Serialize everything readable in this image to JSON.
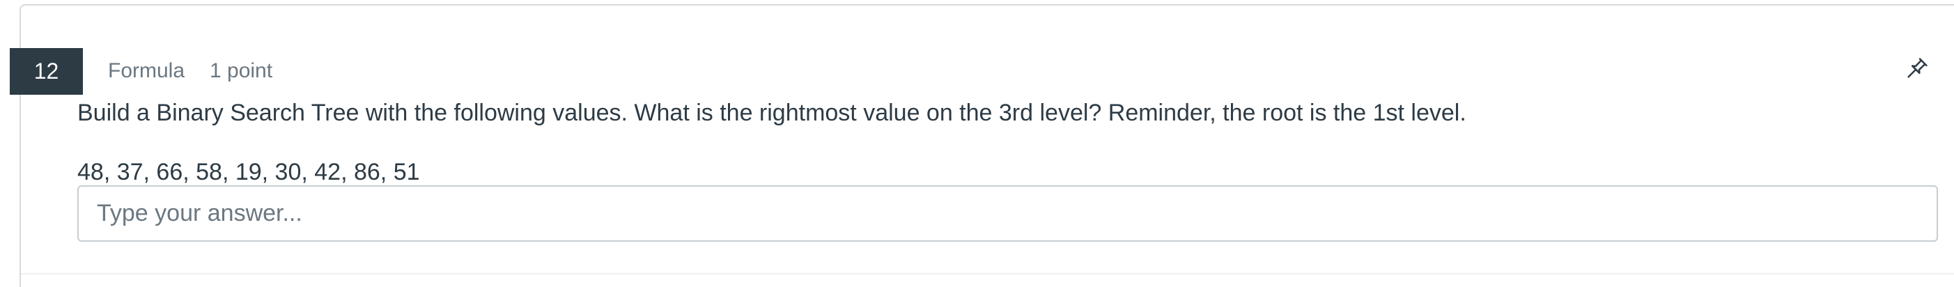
{
  "question": {
    "number": "12",
    "type": "Formula",
    "points": "1 point",
    "text": "Build a Binary Search Tree with the following values. What is the rightmost value on the 3rd level? Reminder, the root is the 1st level.",
    "values": "48, 37, 66, 58, 19, 30, 42, 86, 51",
    "pin_icon": "pin-icon"
  },
  "answer": {
    "value": "",
    "placeholder": "Type your answer..."
  },
  "colors": {
    "badge_background": "#2d3b45",
    "badge_text": "#ffffff",
    "text": "#2d3b45",
    "muted_text": "#6b7780",
    "border": "#c7cdd1"
  }
}
